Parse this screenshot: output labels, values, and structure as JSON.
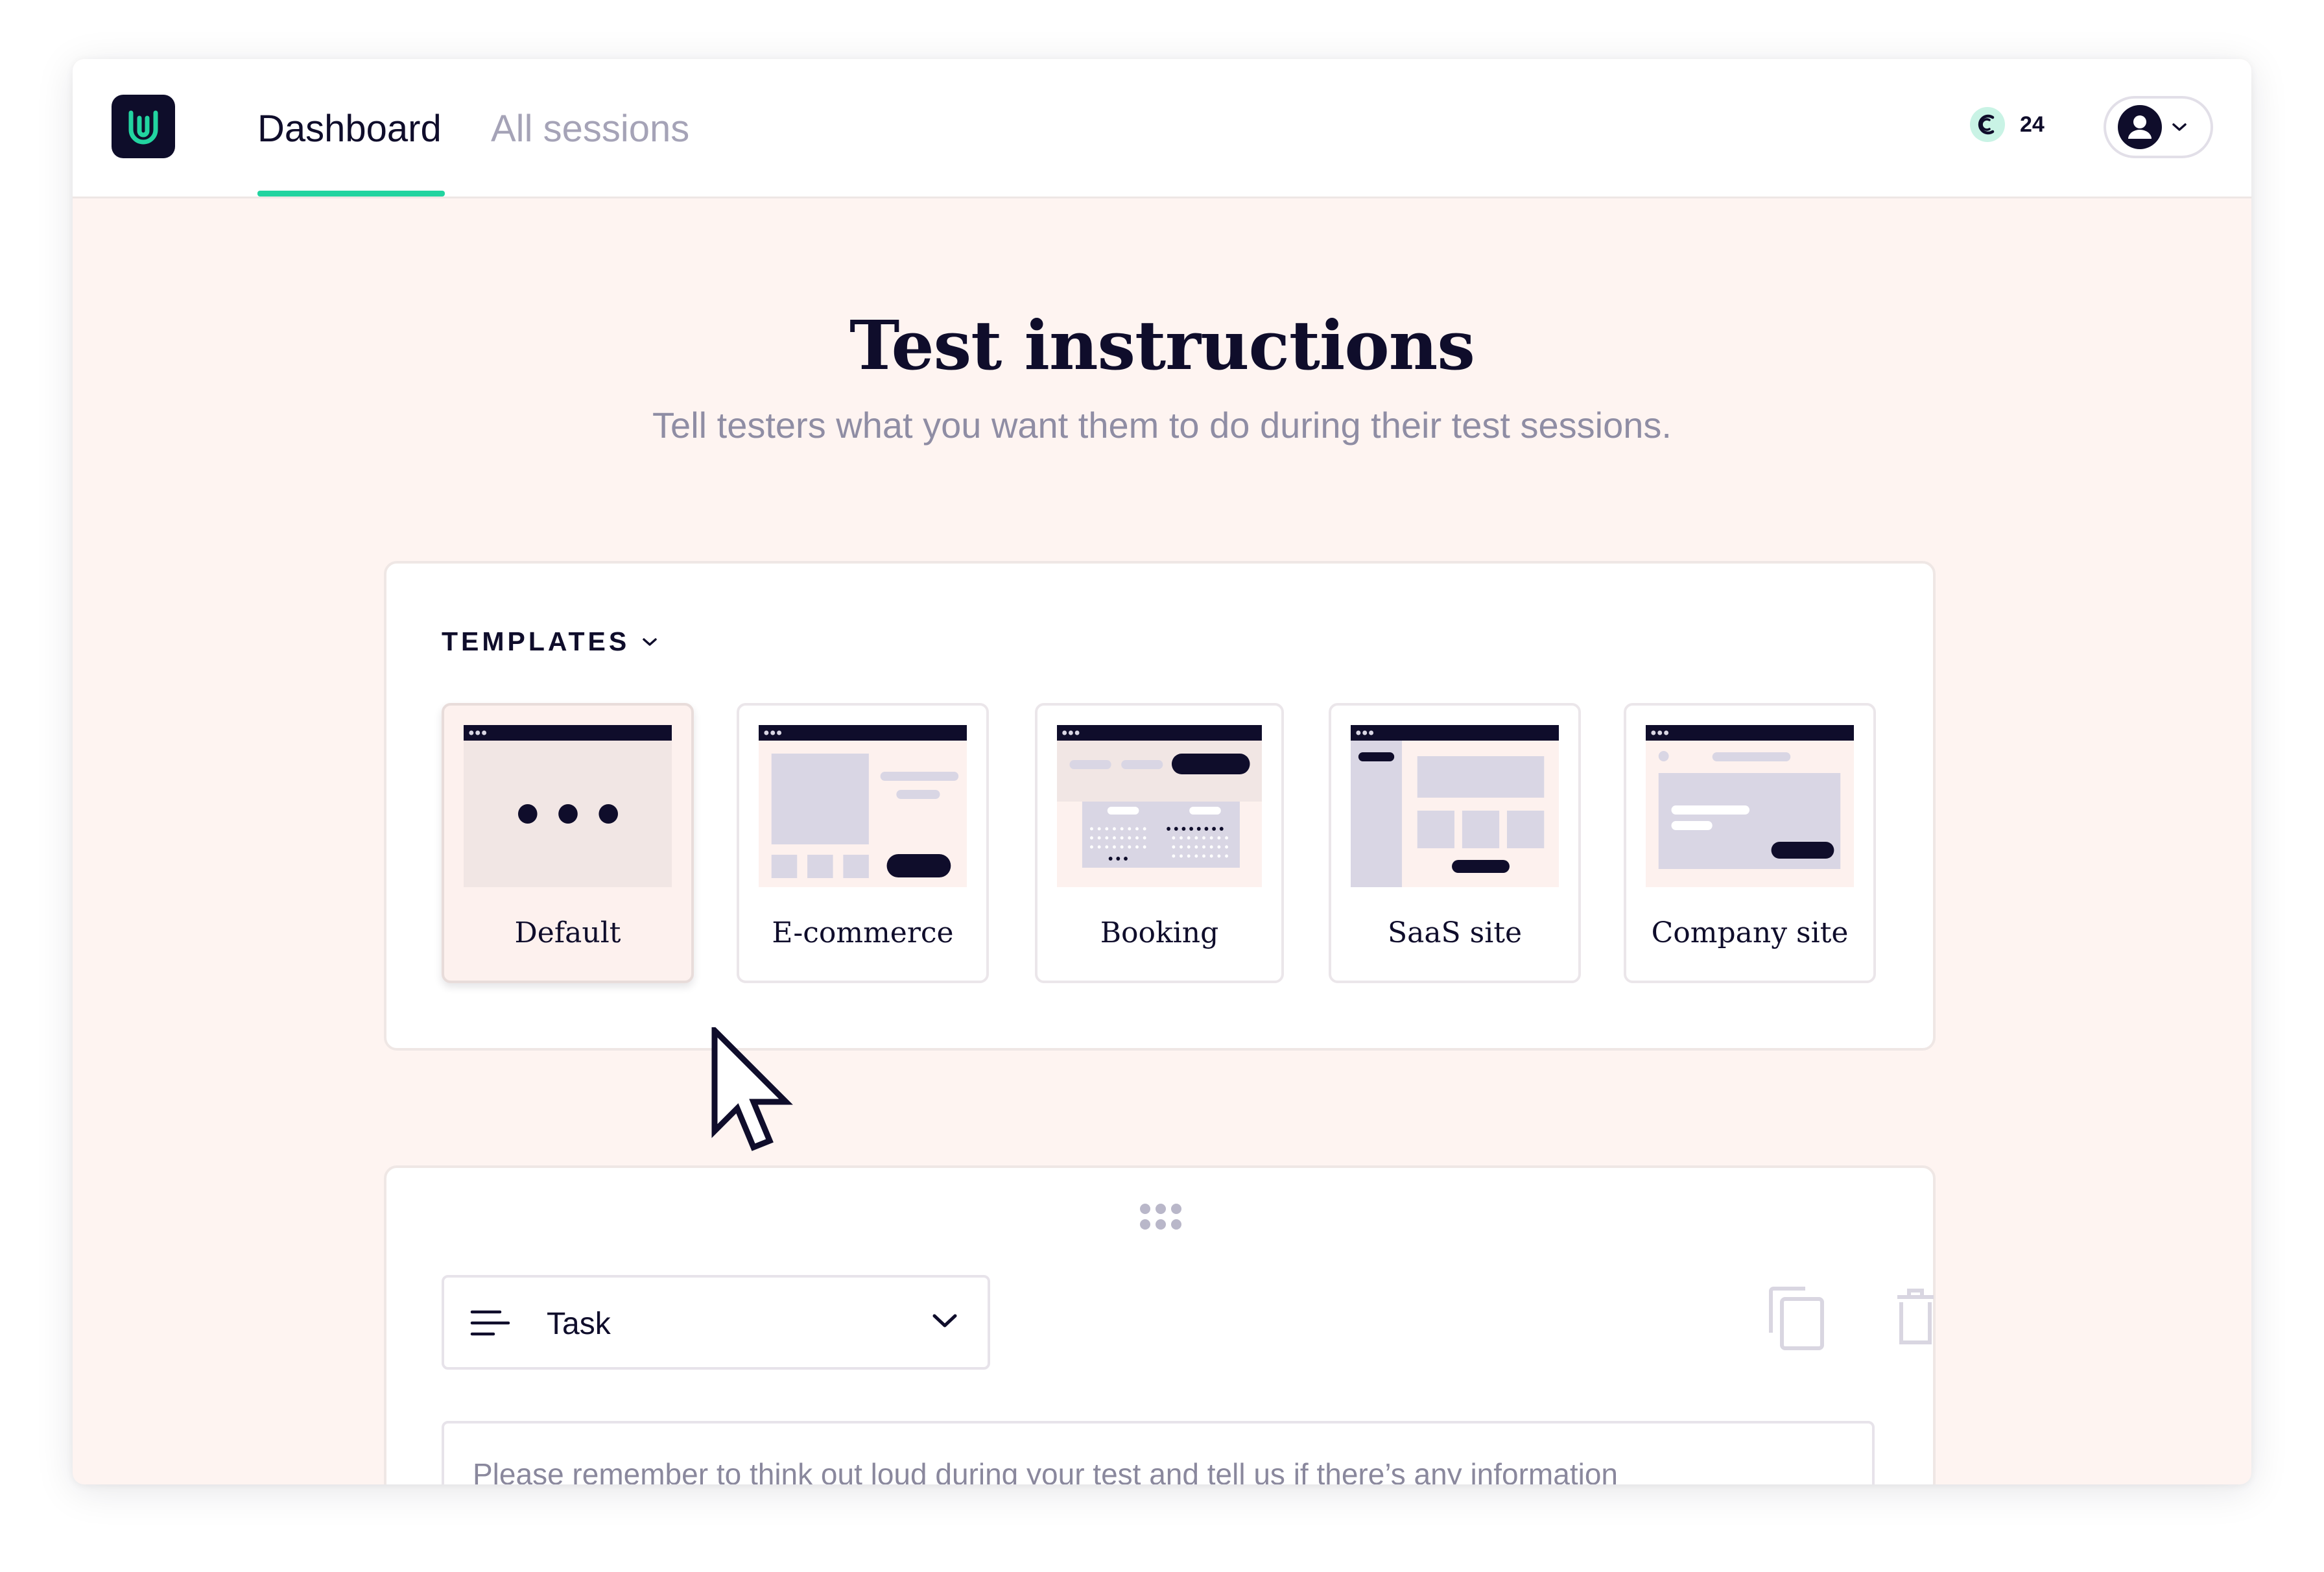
{
  "app": {
    "brand_color": "#0e0d2a",
    "accent_color": "#22d4a0"
  },
  "nav": {
    "tabs": [
      {
        "label": "Dashboard",
        "active": true
      },
      {
        "label": "All sessions",
        "active": false
      }
    ]
  },
  "credits": {
    "icon": "credits-coin-icon",
    "count": "24"
  },
  "user_menu": {
    "icon": "user-avatar-icon"
  },
  "page": {
    "title": "Test instructions",
    "subtitle": "Tell testers what you want them to do during their test sessions."
  },
  "templates": {
    "heading": "TEMPLATES",
    "items": [
      {
        "label": "Default",
        "selected": true
      },
      {
        "label": "E-commerce",
        "selected": false
      },
      {
        "label": "Booking",
        "selected": false
      },
      {
        "label": "SaaS site",
        "selected": false
      },
      {
        "label": "Company site",
        "selected": false
      }
    ]
  },
  "task": {
    "type_label": "Task",
    "instruction_text": "Please remember to think out loud during your test and tell us if there’s any information"
  }
}
